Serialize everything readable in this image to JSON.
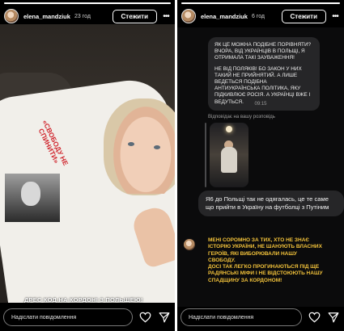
{
  "left_story": {
    "username": "elena_mandziuk",
    "time": "23 год",
    "follow_label": "Стежити",
    "slogan": "«СВОБОДУ НЕ СПИНИТИ»",
    "caption": "ДРЕС КОД НА КОРДОНІ З ПОЛЬЩЕЮ!",
    "message_placeholder": "Надіслати повідомлення"
  },
  "right_story": {
    "username": "elena_mandziuk",
    "time": "6 год",
    "follow_label": "Стежити",
    "message_block_1": "ЯК ЦЕ МОЖНА ПОДІБНЕ ПОРІВНЯТИ? ВЧОРА, ВІД УКРАЇНЦІВ В ПОЛЬЩІ, Я ОТРИМАЛА ТАКІ ЗАУВАЖЕННЯ!",
    "message_block_2": "НЕ ВІД ПОЛЯКІВ! БО ЗАКОН У НИХ ТАКИЙ НЕ ПРИЙНЯТИЙ. А ЛИШЕ ВЕДЕТЬСЯ ПОДІБНА АНТИУКРАЇНСЬКА ПОЛІТИКА, ЯКУ ПІДКИВЛЮЄ РОСІЯ. А УКРАЇНЦІ ВЖЕ І ВЕДУТЬСЯ.",
    "chat_time": "09:15",
    "replied_label": "Відповідає на вашу розповідь",
    "reply_message": "Я6 до Польщі так не одягалась, це те саме що прийти в Україну на футболці з Путіним",
    "yellow_text_1": "МЕНІ СОРОМНО ЗА ТИХ, ХТО НЕ ЗНАЄ ІСТОРІЮ УКРАЇНИ, НЕ ШАНУЮТЬ ВЛАСНИХ ГЕРОЇВ, ЯКІ ВИБОРЮВАЛИ НАШУ СВОБОДУ.",
    "yellow_text_2": "ДОСІ ТАК ЛЕГКО ПРОГИНАЮТЬСЯ ПІД ЩЕ РАДЯНСЬКІ МІФИ І НЕ ВІДСТОЮЮТЬ НАШУ СПАДЩИНУ ЗА КОРДОНОМ!",
    "message_placeholder": "Надіслати повідомлення"
  },
  "icons": {
    "like": "heart-icon",
    "share": "send-icon",
    "more": "more-dots-icon"
  },
  "colors": {
    "slogan_red": "#d0272f",
    "yellow_text": "#f2c23a",
    "bubble_gray": "#262628"
  }
}
